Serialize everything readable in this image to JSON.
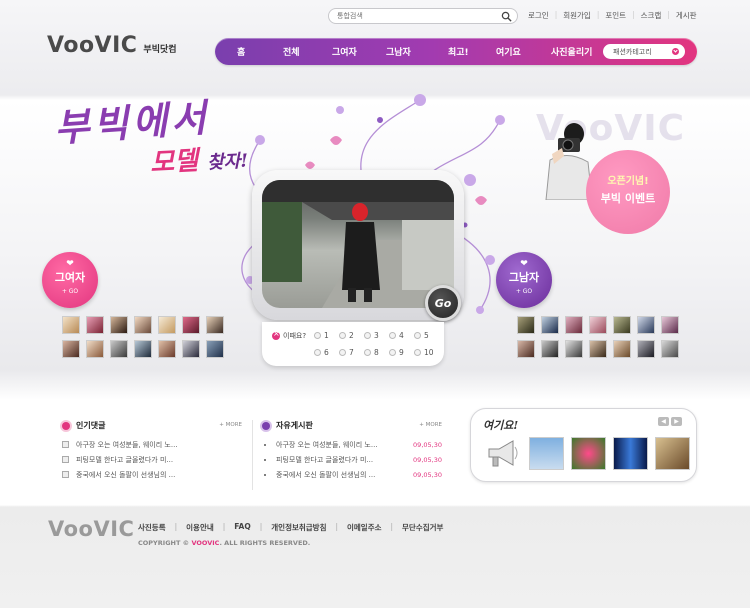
{
  "header": {
    "search_placeholder": "통합검색",
    "util_links": [
      "로그인",
      "회원가입",
      "포인트",
      "스크랩",
      "게시판"
    ],
    "logo_wordmark": "VooVIC",
    "logo_sub": "부빅닷컴",
    "nav": [
      "홈",
      "전체",
      "그여자",
      "그남자",
      "최고!",
      "여기요",
      "사진올리기"
    ],
    "nav_select": "패션카테고리"
  },
  "hero": {
    "title1": "부빅에서",
    "title2_main": "모델",
    "title2_small": "찾자!",
    "go_label": "Go",
    "pager_label": "이때요?",
    "pages": [
      "1",
      "2",
      "3",
      "4",
      "5",
      "6",
      "7",
      "8",
      "9",
      "10"
    ]
  },
  "badges": {
    "her": {
      "title": "그여자",
      "go": "+ GO"
    },
    "him": {
      "title": "그남자",
      "go": "+ GO"
    }
  },
  "event": {
    "ghost_logo": "VooVIC",
    "line1": "오픈기념!",
    "line2": "부빅 이벤트"
  },
  "board_popular": {
    "title": "인기댓글",
    "more": "+ MORE",
    "items": [
      "아구장 오는 여성분들, 웨이리 노...",
      "피팅모델 한다고 글올렸다가 미...",
      "중국에서 오신 돌팔이 선생님의 ..."
    ]
  },
  "board_free": {
    "title": "자유게시판",
    "more": "+ MORE",
    "items": [
      {
        "text": "아구장 오는 여성분들, 웨이리 노...",
        "date": "09,05,30"
      },
      {
        "text": "피팅모델 한다고 글올렸다가 미...",
        "date": "09,05,30"
      },
      {
        "text": "중국에서 오신 돌팔이 선생님의 ...",
        "date": "09,05,30"
      }
    ]
  },
  "yeogiyo": {
    "title": "여기요!"
  },
  "footer": {
    "logo": "VooVIC",
    "links": [
      "사진등록",
      "이용안내",
      "FAQ",
      "개인정보취급방침",
      "이메일주소",
      "무단수집거부"
    ],
    "copyright_prefix": "COPYRIGHT © ",
    "copyright_brand": "VOOVIC",
    "copyright_suffix": ". ALL RIGHTS RESERVED."
  },
  "colors": {
    "accent_pink": "#e2357f",
    "accent_purple": "#7a3fae"
  }
}
